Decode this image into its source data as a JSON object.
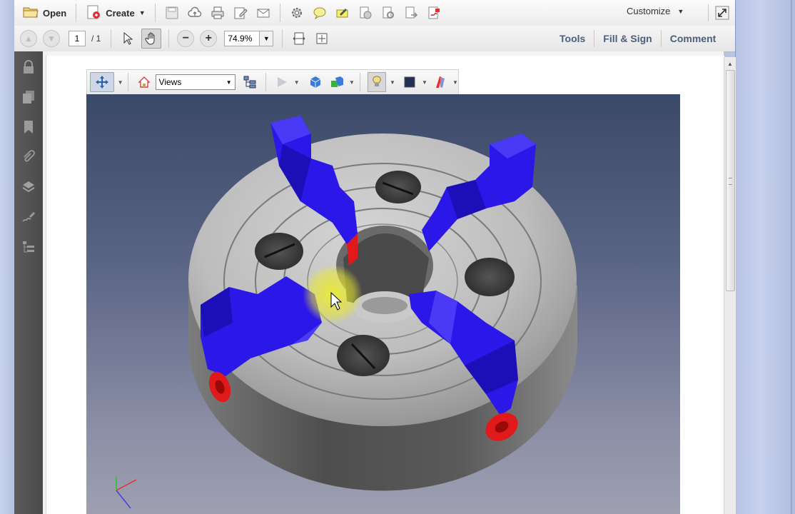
{
  "toolbar": {
    "open_label": "Open",
    "create_label": "Create",
    "customize_label": "Customize"
  },
  "nav": {
    "page_current": "1",
    "page_total": "/ 1",
    "zoom_value": "74.9%"
  },
  "right_panel": {
    "tools_label": "Tools",
    "fill_sign_label": "Fill & Sign",
    "comment_label": "Comment"
  },
  "toolbar3d": {
    "views_value": "Views"
  },
  "colors": {
    "jaw_blue": "#2b17e8",
    "screw_red": "#e01a1a",
    "chuck_gray": "#c9c9c9",
    "viewport_top": "#3b4968",
    "viewport_bottom": "#9e9fb1",
    "highlight_yellow": "#f0f020"
  },
  "icons": [
    "folder-open-icon",
    "create-pdf-icon",
    "save-icon",
    "upload-cloud-icon",
    "print-icon",
    "edit-icon",
    "email-icon",
    "gear-icon",
    "comment-bubble-icon",
    "highlight-icon",
    "lock-doc-icon",
    "stamp-icon",
    "share-icon",
    "sign-icon",
    "expand-icon",
    "lock-icon",
    "pages-icon",
    "bookmark-icon",
    "attachment-icon",
    "layers-icon",
    "signature-icon",
    "content-tree-icon"
  ]
}
